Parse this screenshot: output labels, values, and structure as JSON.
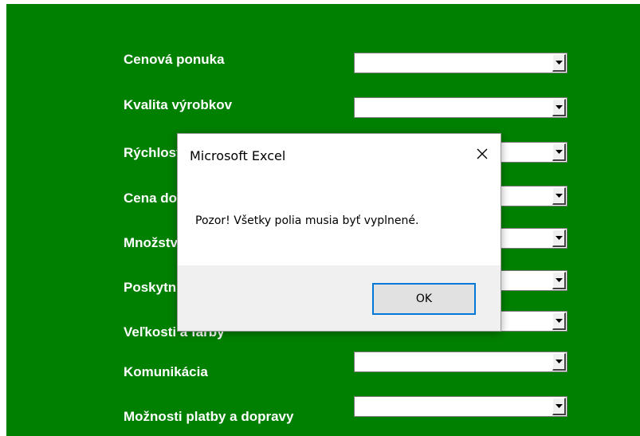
{
  "form": {
    "rows": [
      {
        "label": "Cenová ponuka",
        "value": ""
      },
      {
        "label": "Kvalita výrobkov",
        "value": ""
      },
      {
        "label": "Rýchlosť dodania",
        "value": ""
      },
      {
        "label": "Cena dopravy",
        "value": ""
      },
      {
        "label": "Množstvo tovaru",
        "value": ""
      },
      {
        "label": "Poskytnuté služby",
        "value": ""
      },
      {
        "label": "Veľkosti a farby",
        "value": ""
      },
      {
        "label": "Komunikácia",
        "value": ""
      },
      {
        "label": "Možnosti platby a dopravy",
        "value": ""
      }
    ]
  },
  "dialog": {
    "title": "Microsoft Excel",
    "message": "Pozor! Všetky polia musia byť vyplnené.",
    "ok_label": "OK",
    "close_icon": "close-icon"
  },
  "colors": {
    "form_background": "#008000",
    "label_text": "#ffffff",
    "dialog_footer": "#f0f0f0",
    "button_focus": "#0078d7"
  }
}
